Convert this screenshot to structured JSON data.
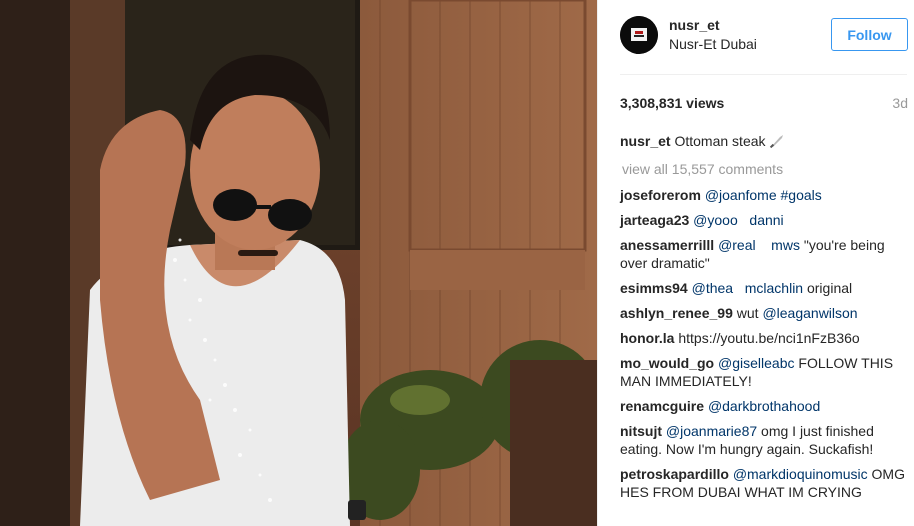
{
  "post": {
    "username": "nusr_et",
    "location": "Nusr-Et Dubai",
    "follow_label": "Follow",
    "views": "3,308,831 views",
    "time_ago": "3d",
    "caption_author": "nusr_et",
    "caption_text": "Ottoman steak",
    "view_all": "view all 15,557 comments"
  },
  "comments": [
    {
      "author": "joseforerom",
      "mention": "@joanfome #goals",
      "text": ""
    },
    {
      "author": "jarteaga23",
      "mention": "@yooo   danni",
      "text": ""
    },
    {
      "author": "anessamerrilll",
      "mention": "@real    mws",
      "text": "\"you're being over dramatic\""
    },
    {
      "author": "esimms94",
      "mention": "@thea   mclachlin",
      "text": "original"
    },
    {
      "author": "ashlyn_renee_99",
      "mention": "",
      "text": "wut",
      "mention2": "@leaganwilson"
    },
    {
      "author": "honor.la",
      "mention": "",
      "text": "https://youtu.be/nci1nFzB36o"
    },
    {
      "author": "mo_would_go",
      "mention": "@giselleabc",
      "text": "FOLLOW THIS MAN IMMEDIATELY!"
    },
    {
      "author": "renamcguire",
      "mention": "@darkbrothahood",
      "text": ""
    },
    {
      "author": "nitsujt",
      "mention": "@joanmarie87",
      "text": "omg I just finished eating. Now I'm hungry again. Suckafish!"
    },
    {
      "author": "petroskapardillo",
      "mention": "@markdioquinomusic",
      "text": "OMG HES FROM DUBAI WHAT IM CRYING"
    }
  ],
  "icons": {
    "caption_emoji": "knife-icon",
    "avatar": "nusr-et-logo"
  },
  "colors": {
    "follow_blue": "#3897f0",
    "mention_blue": "#003569",
    "muted_gray": "#999999"
  }
}
